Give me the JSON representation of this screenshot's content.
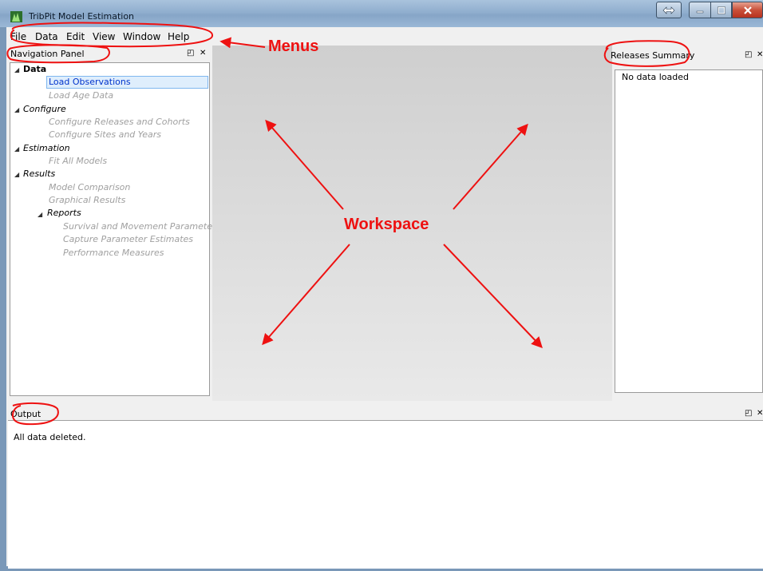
{
  "window": {
    "title": "TribPit Model Estimation"
  },
  "menu": [
    "File",
    "Data",
    "Edit",
    "View",
    "Window",
    "Help"
  ],
  "navigation_panel": {
    "title": "Navigation Panel",
    "tree": {
      "data": {
        "label": "Data",
        "items": [
          "Load Observations",
          "Load Age Data"
        ]
      },
      "configure": {
        "label": "Configure",
        "items": [
          "Configure Releases and Cohorts",
          "Configure Sites and Years"
        ]
      },
      "estimation": {
        "label": "Estimation",
        "items": [
          "Fit All Models"
        ]
      },
      "results": {
        "label": "Results",
        "items": [
          "Model Comparison",
          "Graphical Results"
        ],
        "reports": {
          "label": "Reports",
          "items": [
            "Survival and Movement Paramete...",
            "Capture Parameter Estimates",
            "Performance Measures"
          ]
        }
      }
    },
    "selected": "Load Observations"
  },
  "releases_summary": {
    "title": "Releases Summary",
    "content": "No data loaded"
  },
  "output": {
    "title": "Output",
    "content": "All data deleted."
  },
  "annotations": {
    "menus": "Menus",
    "workspace": "Workspace"
  },
  "dock_buttons": {
    "float": "◰",
    "close": "✕"
  },
  "colors": {
    "annotation": "#ee1111",
    "selection_bg": "#dfeefc",
    "disabled_text": "#a0a0a0",
    "link_text": "#0033cc"
  }
}
